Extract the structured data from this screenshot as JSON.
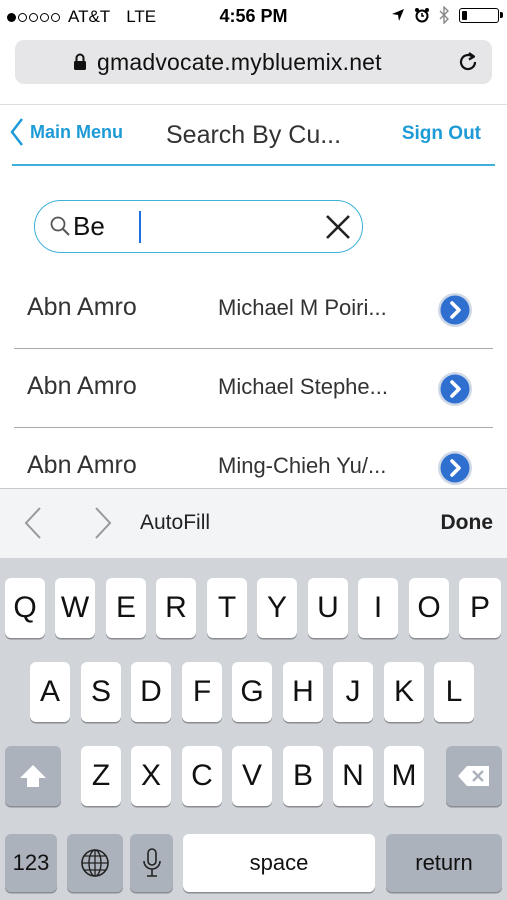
{
  "status_bar": {
    "carrier": "AT&T",
    "network": "LTE",
    "time": "4:56 PM",
    "signal_bars_filled": 1,
    "signal_bars_total": 5,
    "battery_level": 0.12,
    "icons": [
      "location-arrow-icon",
      "alarm-icon",
      "bluetooth-icon",
      "battery-icon"
    ]
  },
  "browser": {
    "url": "gmadvocate.mybluemix.net",
    "icons": [
      "lock-icon",
      "reload-icon"
    ]
  },
  "header": {
    "back_label": "Main Menu",
    "title": "Search By Cu...",
    "sign_out_label": "Sign Out",
    "accent_color": "#1e9bd7"
  },
  "search": {
    "value": "Be",
    "icons": [
      "magnifier-icon",
      "clear-icon"
    ]
  },
  "results": [
    {
      "account": "Abn Amro",
      "contact": "Michael M Poiri..."
    },
    {
      "account": "Abn Amro",
      "contact": "Michael Stephe..."
    },
    {
      "account": "Abn Amro",
      "contact": "Ming-Chieh Yu/..."
    }
  ],
  "accessory_bar": {
    "autofill_label": "AutoFill",
    "done_label": "Done"
  },
  "keyboard": {
    "row1": [
      "Q",
      "W",
      "E",
      "R",
      "T",
      "Y",
      "U",
      "I",
      "O",
      "P"
    ],
    "row2": [
      "A",
      "S",
      "D",
      "F",
      "G",
      "H",
      "J",
      "K",
      "L"
    ],
    "row3": [
      "Z",
      "X",
      "C",
      "V",
      "B",
      "N",
      "M"
    ],
    "numbers_label": "123",
    "space_label": "space",
    "return_label": "return"
  }
}
